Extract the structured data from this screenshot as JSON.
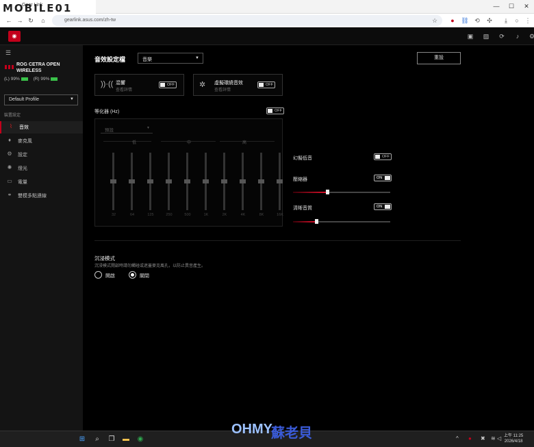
{
  "browser": {
    "tab_title": "Gear Link",
    "url": "gearlink.asus.com/zh-tw",
    "watermark": "MOBILE01",
    "window_controls": [
      "—",
      "☐",
      "✕"
    ]
  },
  "sidebar": {
    "device_name": "ROG CETRA OPEN WIRELESS",
    "battery_left": "(L) 99%",
    "battery_right": "(R) 99%",
    "profile": "Default Profile",
    "section_heading": "裝置設定",
    "items": [
      {
        "label": "音效",
        "icon": "sound-wave-icon",
        "active": true
      },
      {
        "label": "麥克風",
        "icon": "microphone-icon",
        "active": false
      },
      {
        "label": "設定",
        "icon": "gear-icon",
        "active": false
      },
      {
        "label": "燈光",
        "icon": "light-icon",
        "active": false
      },
      {
        "label": "電量",
        "icon": "battery-icon",
        "active": false
      },
      {
        "label": "雙模多點連線",
        "icon": "link-icon",
        "active": false
      }
    ]
  },
  "main": {
    "sound_profile_label": "音效設定檔",
    "sound_profile_value": "音樂",
    "reset_label": "重設",
    "cards": [
      {
        "title": "混響",
        "subtitle": "查看詳情",
        "toggle": "OFF"
      },
      {
        "title": "虛擬環繞音效",
        "subtitle": "查看詳情",
        "toggle": "OFF"
      }
    ],
    "eq": {
      "label": "等化器 (Hz)",
      "toggle": "OFF",
      "preset": "預設",
      "bands": [
        "低",
        "中",
        "高"
      ],
      "frequencies": [
        "32",
        "64",
        "125",
        "250",
        "500",
        "1K",
        "2K",
        "4K",
        "8K",
        "16K"
      ],
      "levels": [
        0,
        0,
        0,
        0,
        0,
        0,
        0,
        0,
        0,
        0
      ]
    },
    "phantom_bass": {
      "label": "幻擬低音",
      "toggle": "OFF"
    },
    "compressor": {
      "label": "壓縮器",
      "toggle": "ON",
      "level": 0.35
    },
    "clarity": {
      "label": "清晰音質",
      "toggle": "ON",
      "level": 0.24
    },
    "immersive": {
      "title": "沉浸模式",
      "description": "沉浸模式開啟時請勿觸碰或遮蓋麥克風孔，以防止異音產生。",
      "options": [
        {
          "label": "開啟",
          "selected": false
        },
        {
          "label": "關閉",
          "selected": true
        }
      ]
    }
  },
  "taskbar": {
    "overlay_text_1": "OHMY",
    "overlay_text_2": "蘇老貝",
    "time": "上午 11:25",
    "date": "2026/4/18"
  }
}
